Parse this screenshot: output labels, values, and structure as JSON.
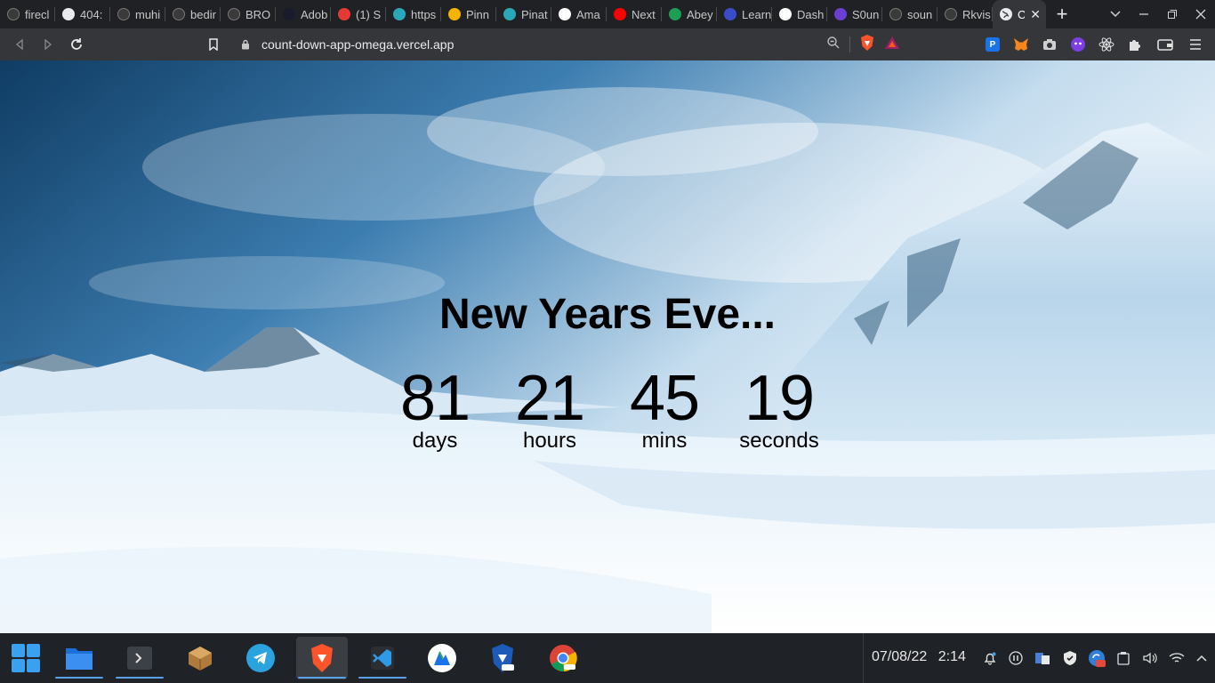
{
  "tabs": [
    {
      "title": "firecl",
      "icon": "github-icon"
    },
    {
      "title": "404:",
      "icon": "globe-icon"
    },
    {
      "title": "muhi",
      "icon": "github-icon"
    },
    {
      "title": "bedir",
      "icon": "github-icon"
    },
    {
      "title": "BRO",
      "icon": "github-icon"
    },
    {
      "title": "Adob",
      "icon": "adobe-icon"
    },
    {
      "title": "(1) S",
      "icon": "red-g-icon"
    },
    {
      "title": "https",
      "icon": "cube-icon"
    },
    {
      "title": "Pinn",
      "icon": "pinn-icon"
    },
    {
      "title": "Pinat",
      "icon": "cube-icon"
    },
    {
      "title": "Ama",
      "icon": "amazon-icon"
    },
    {
      "title": "Next",
      "icon": "youtube-icon"
    },
    {
      "title": "Abey",
      "icon": "leaf-icon"
    },
    {
      "title": "Learn",
      "icon": "learn-icon"
    },
    {
      "title": "Dash",
      "icon": "triangle-icon"
    },
    {
      "title": "S0un",
      "icon": "sound-icon"
    },
    {
      "title": "soun",
      "icon": "github-icon"
    },
    {
      "title": "Rkvis",
      "icon": "github-icon"
    }
  ],
  "active_tab": {
    "title": "C",
    "close": "✕"
  },
  "new_tab_label": "+",
  "toolbar": {
    "url": "count-down-app-omega.vercel.app"
  },
  "countdown": {
    "title": "New Years Eve...",
    "units": [
      {
        "value": "81",
        "label": "days"
      },
      {
        "value": "21",
        "label": "hours"
      },
      {
        "value": "45",
        "label": "mins"
      },
      {
        "value": "19",
        "label": "seconds"
      }
    ]
  },
  "taskbar": {
    "date": "07/08/22",
    "time": "2:14"
  }
}
